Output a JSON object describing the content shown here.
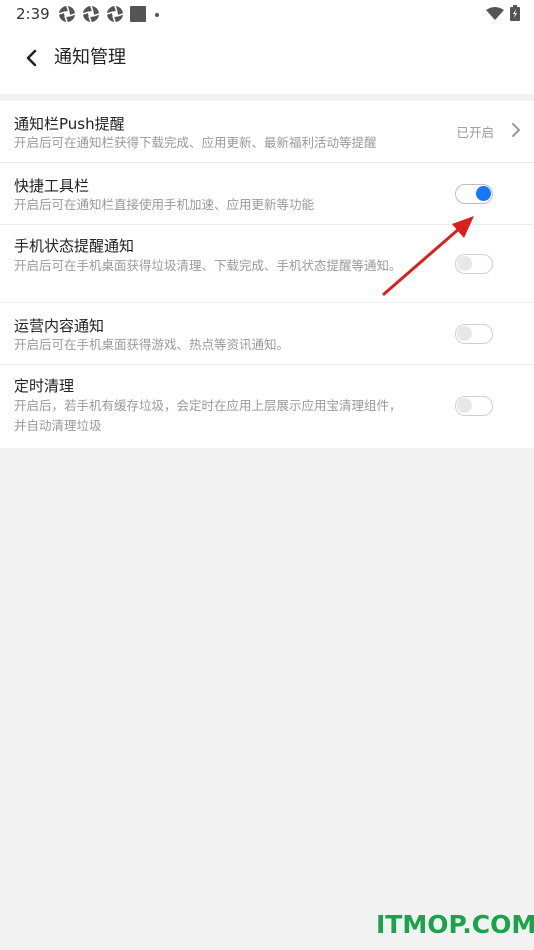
{
  "status_bar": {
    "time": "2:39",
    "icons": [
      "aperture-icon",
      "aperture-icon",
      "aperture-icon",
      "square-icon",
      "dot-icon"
    ],
    "right_icons": [
      "wifi-icon",
      "battery-icon"
    ]
  },
  "header": {
    "title": "通知管理"
  },
  "settings": [
    {
      "title": "通知栏Push提醒",
      "subtitle": "开启后可在通知栏获得下载完成、应用更新、最新福利活动等提醒",
      "state_label": "已开启"
    },
    {
      "title": "快捷工具栏",
      "subtitle": "开启后可在通知栏直接使用手机加速、应用更新等功能",
      "enabled": true
    },
    {
      "title": "手机状态提醒通知",
      "subtitle": "开启后可在手机桌面获得垃圾清理、下载完成、手机状态提醒等通知。",
      "enabled": false
    },
    {
      "title": "运营内容通知",
      "subtitle": "开启后可在手机桌面获得游戏、热点等资讯通知。",
      "enabled": false
    },
    {
      "title": "定时清理",
      "subtitle": "开启后，若手机有缓存垃圾，会定时在应用上层展示应用宝清理组件，并自动清理垃圾",
      "enabled": false
    }
  ],
  "colors": {
    "accent": "#1677ff",
    "annotation_arrow": "#d9201c",
    "watermark": "#1aa34a"
  },
  "watermark": "ITMOP.COM"
}
